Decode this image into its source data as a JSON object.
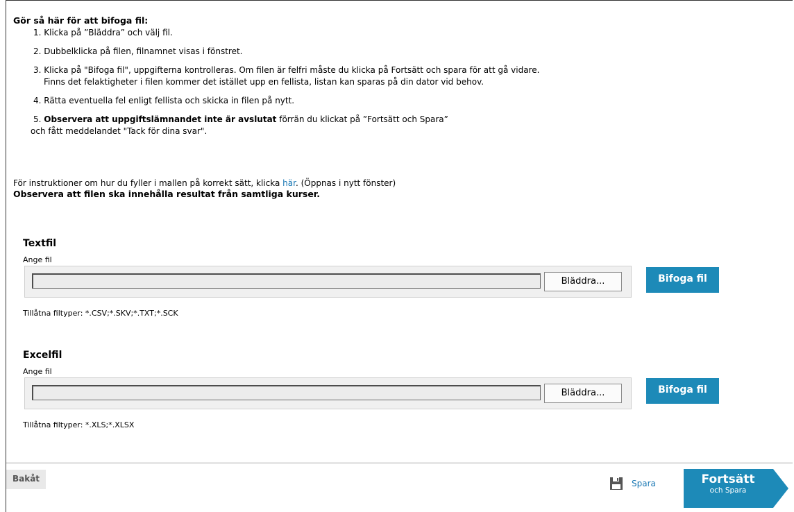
{
  "instructions": {
    "title": "Gör så här för att bifoga fil:",
    "step1": "1. Klicka på ”Bläddra” och välj fil.",
    "step2": "2. Dubbelklicka på filen, filnamnet visas i fönstret.",
    "step3_line1": "3. Klicka på \"Bifoga fil\", uppgifterna kontrolleras. Om filen är felfri måste du klicka på Fortsätt och spara för att gå vidare.",
    "step3_line2": "Finns det felaktigheter i filen kommer det istället upp en fellista, listan kan sparas på din dator vid behov.",
    "step4": "4. Rätta eventuella fel enligt fellista och skicka in filen på nytt.",
    "step5_prefix": "5. ",
    "step5_bold": "Observera att uppgiftslämnandet inte är avslutat",
    "step5_rest": " förrän du klickat på ”Fortsätt och Spara”",
    "step5_line2": "och fått meddelandet \"Tack för dina svar\"."
  },
  "note": {
    "text_before": "För instruktioner om hur du fyller i mallen på korrekt sätt, klicka ",
    "link": "här",
    "text_after": ". (Öppnas i nytt fönster)",
    "bold": "Observera att filen ska innehålla resultat från samtliga kurser."
  },
  "textfil": {
    "title": "Textfil",
    "label": "Ange fil",
    "value": "",
    "browse": "Bläddra...",
    "attach": "Bifoga fil",
    "filetypes": "Tillåtna filtyper: *.CSV;*.SKV;*.TXT;*.SCK"
  },
  "excelfil": {
    "title": "Excelfil",
    "label": "Ange fil",
    "value": "",
    "browse": "Bläddra...",
    "attach": "Bifoga fil",
    "filetypes": "Tillåtna filtyper: *.XLS;*.XLSX"
  },
  "footer": {
    "back": "Bakåt",
    "save": "Spara",
    "save_icon": "floppy-disk-icon",
    "continue_main": "Fortsätt",
    "continue_sub": "och Spara"
  },
  "colors": {
    "accent": "#1d8ab8",
    "link": "#1a78b4"
  }
}
